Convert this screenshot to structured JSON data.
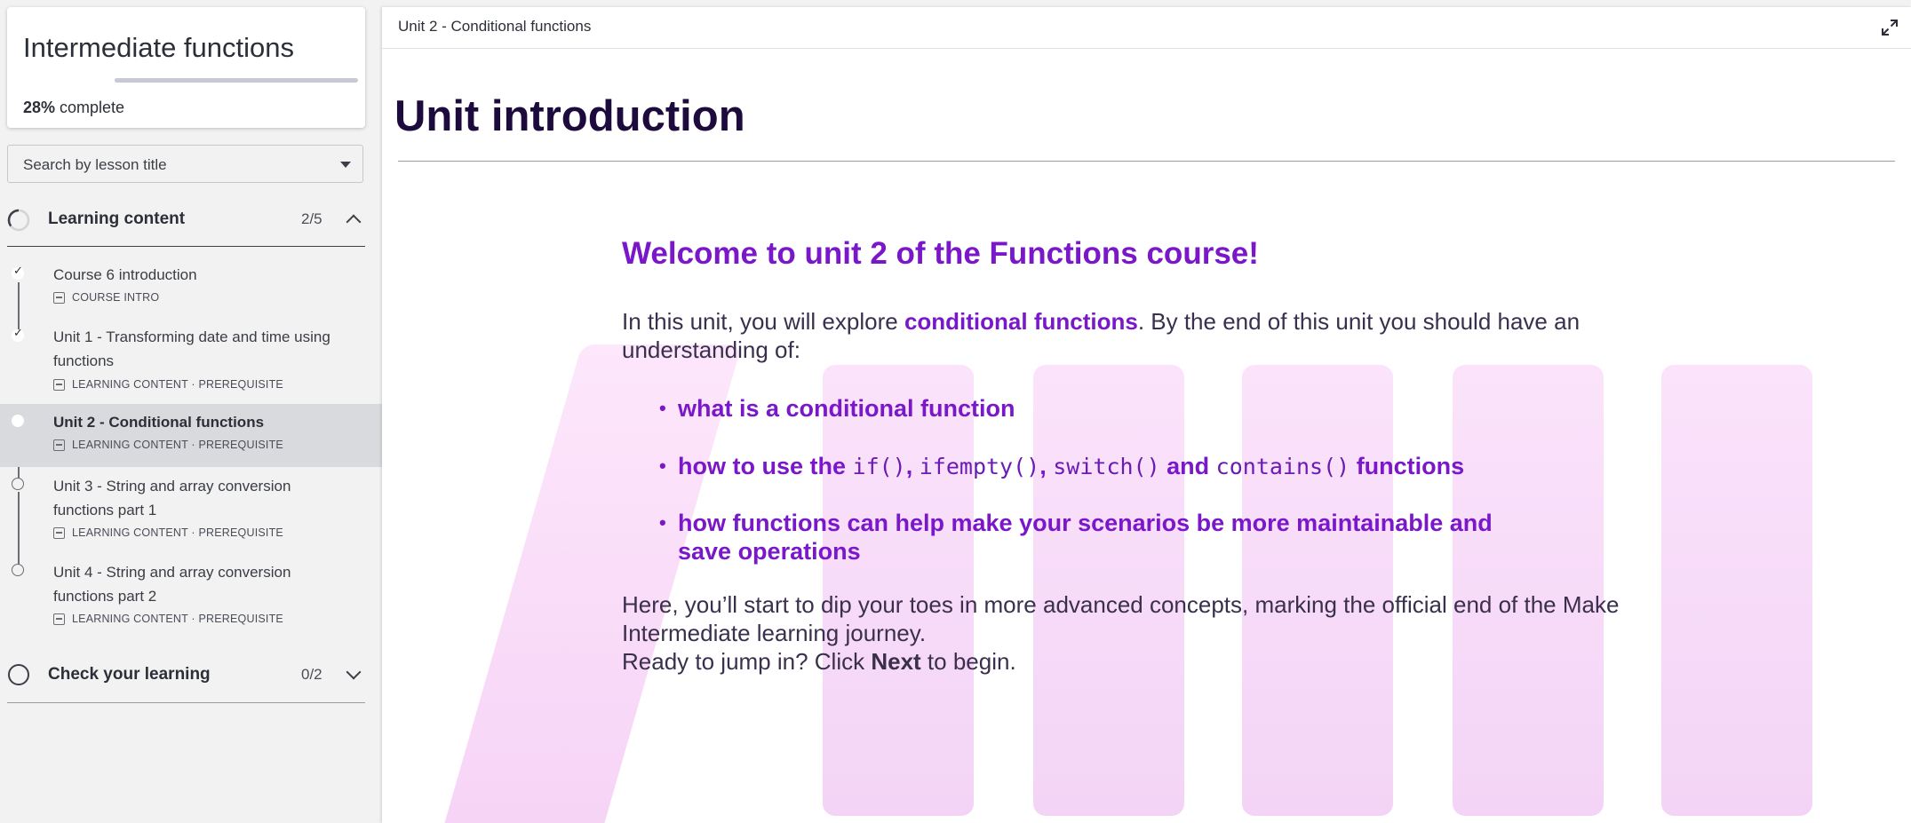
{
  "sidebar": {
    "course_title": "Intermediate functions",
    "progress_percent": "28%",
    "progress_suffix": " complete",
    "progress_fraction": 0.28,
    "search_placeholder": "Search by lesson title",
    "sections": [
      {
        "title": "Learning content",
        "count": "2/5",
        "expanded": true,
        "lessons": [
          {
            "title": "Course 6 introduction",
            "meta": "COURSE INTRO",
            "status": "complete",
            "icon": "document-icon"
          },
          {
            "title": "Unit 1 - Transforming date and time using functions",
            "meta": "LEARNING CONTENT · PREREQUISITE",
            "status": "complete",
            "icon": "video-icon"
          },
          {
            "title": "Unit 2 - Conditional functions",
            "meta": "LEARNING CONTENT · PREREQUISITE",
            "status": "current",
            "icon": "video-icon"
          },
          {
            "title": "Unit 3 - String and array conversion functions part 1",
            "meta": "LEARNING CONTENT · PREREQUISITE",
            "status": "not-started",
            "icon": "video-icon"
          },
          {
            "title": "Unit 4 - String and array conversion functions part 2",
            "meta": "LEARNING CONTENT · PREREQUISITE",
            "status": "not-started",
            "icon": "video-icon"
          }
        ]
      },
      {
        "title": "Check your learning",
        "count": "0/2",
        "expanded": false
      }
    ]
  },
  "main": {
    "breadcrumb": "Unit 2 - Conditional functions",
    "page_title": "Unit introduction",
    "welcome": "Welcome to unit 2 of the Functions course!",
    "intro_prefix": "In this unit, you will explore ",
    "intro_highlight": "conditional functions",
    "intro_suffix": ". By the end of this unit you should have an understanding of:",
    "bullet1": "what is a conditional function",
    "bullet2_prefix": "how to use the ",
    "bullet2_code1": "if()",
    "bullet2_sep1": ", ",
    "bullet2_code2": "ifempty()",
    "bullet2_sep2": ", ",
    "bullet2_code3": "switch()",
    "bullet2_and": " and ",
    "bullet2_code4": "contains()",
    "bullet2_suffix": " functions",
    "bullet3": "how functions can help make your scenarios be more maintainable and save operations",
    "para2": "Here, you’ll start to dip your toes in more advanced concepts, marking the official end of the Make Intermediate learning journey.",
    "para3_prefix": "Ready to jump in? Click ",
    "para3_bold": "Next",
    "para3_suffix": " to begin.",
    "accent_color": "#7a18c9",
    "title_color": "#1e0b3d"
  }
}
